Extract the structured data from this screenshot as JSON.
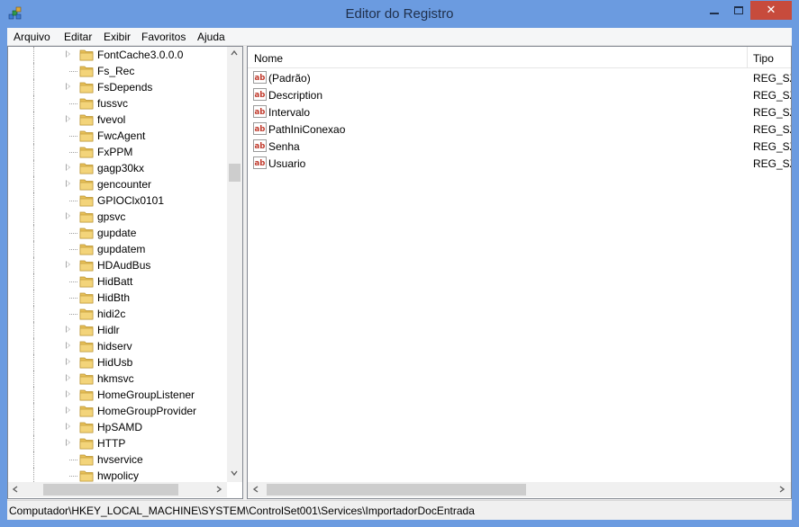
{
  "window": {
    "title": "Editor do Registro",
    "close_glyph": "✕"
  },
  "menu": [
    "Arquivo",
    "Editar",
    "Exibir",
    "Favoritos",
    "Ajuda"
  ],
  "tree": {
    "items": [
      {
        "label": "FontCache3.0.0.0",
        "expandable": true
      },
      {
        "label": "Fs_Rec",
        "expandable": false
      },
      {
        "label": "FsDepends",
        "expandable": true
      },
      {
        "label": "fussvc",
        "expandable": false
      },
      {
        "label": "fvevol",
        "expandable": true
      },
      {
        "label": "FwcAgent",
        "expandable": false
      },
      {
        "label": "FxPPM",
        "expandable": false
      },
      {
        "label": "gagp30kx",
        "expandable": true
      },
      {
        "label": "gencounter",
        "expandable": true
      },
      {
        "label": "GPIOClx0101",
        "expandable": false
      },
      {
        "label": "gpsvc",
        "expandable": true
      },
      {
        "label": "gupdate",
        "expandable": false
      },
      {
        "label": "gupdatem",
        "expandable": false
      },
      {
        "label": "HDAudBus",
        "expandable": true
      },
      {
        "label": "HidBatt",
        "expandable": false
      },
      {
        "label": "HidBth",
        "expandable": false
      },
      {
        "label": "hidi2c",
        "expandable": false
      },
      {
        "label": "Hidlr",
        "expandable": true
      },
      {
        "label": "hidserv",
        "expandable": true
      },
      {
        "label": "HidUsb",
        "expandable": true
      },
      {
        "label": "hkmsvc",
        "expandable": true
      },
      {
        "label": "HomeGroupListener",
        "expandable": true
      },
      {
        "label": "HomeGroupProvider",
        "expandable": true
      },
      {
        "label": "HpSAMD",
        "expandable": true
      },
      {
        "label": "HTTP",
        "expandable": true
      },
      {
        "label": "hvservice",
        "expandable": false
      },
      {
        "label": "hwpolicy",
        "expandable": false
      }
    ]
  },
  "list": {
    "columns": [
      "Nome",
      "Tipo"
    ],
    "rows": [
      {
        "name": "(Padrão)",
        "type": "REG_SZ"
      },
      {
        "name": "Description",
        "type": "REG_SZ"
      },
      {
        "name": "Intervalo",
        "type": "REG_SZ"
      },
      {
        "name": "PathIniConexao",
        "type": "REG_SZ"
      },
      {
        "name": "Senha",
        "type": "REG_SZ"
      },
      {
        "name": "Usuario",
        "type": "REG_SZ"
      }
    ]
  },
  "status": {
    "path": "Computador\\HKEY_LOCAL_MACHINE\\SYSTEM\\ControlSet001\\Services\\ImportadorDocEntrada"
  },
  "colors": {
    "frame": "#6b9be0",
    "close_button": "#c74b3c",
    "folder": "#e8c15a",
    "ab_icon_red": "#c0392b"
  },
  "icons": {
    "app": "registry-editor-icon",
    "folder": "folder-icon",
    "value": "string-value-icon",
    "expander": "triangle-right-icon"
  }
}
